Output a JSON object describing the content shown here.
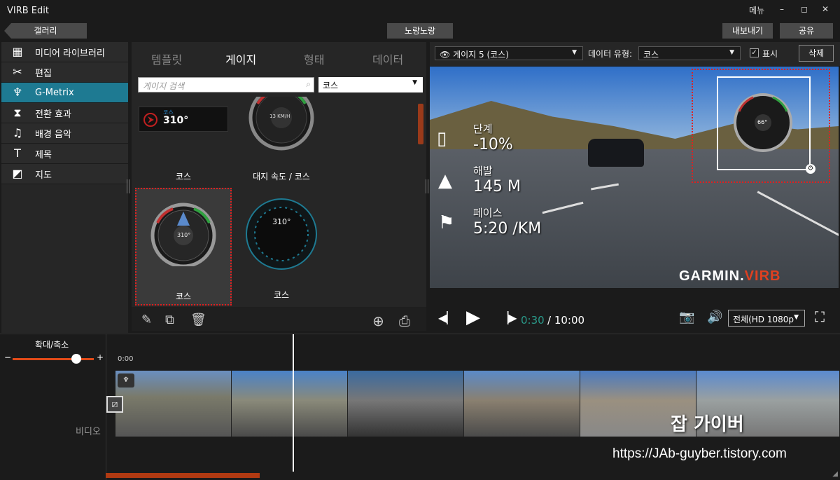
{
  "app": {
    "title": "VIRB Edit",
    "menu_label": "메뉴",
    "minimize": "–",
    "maximize": "◻",
    "close": "✕"
  },
  "nav": {
    "gallery": "갤러리",
    "project_name": "노랑노랑",
    "export": "내보내기",
    "share": "공유"
  },
  "sidebar": {
    "items": [
      {
        "label": "미디어 라이브러리",
        "icon": "film-icon",
        "glyph": "▦"
      },
      {
        "label": "편집",
        "icon": "scissors-icon",
        "glyph": "✂"
      },
      {
        "label": "G-Metrix",
        "icon": "gmetrix-icon",
        "glyph": "♆"
      },
      {
        "label": "전환 효과",
        "icon": "transition-icon",
        "glyph": "⧗"
      },
      {
        "label": "배경 음악",
        "icon": "music-icon",
        "glyph": "♫"
      },
      {
        "label": "제목",
        "icon": "title-icon",
        "glyph": "T"
      },
      {
        "label": "지도",
        "icon": "map-icon",
        "glyph": "◩"
      }
    ],
    "active_index": 2
  },
  "gauge_panel": {
    "tabs": [
      "템플릿",
      "게이지",
      "형태",
      "데이터"
    ],
    "active_tab": 1,
    "search_placeholder": "게이지 검색",
    "type_filter": "코스",
    "gauges": [
      {
        "label": "코스",
        "readout_label": "코스",
        "readout_value": "310°"
      },
      {
        "label": "대지 속도 / 코스",
        "readout_value": "13 KM/H"
      },
      {
        "label": "코스",
        "readout_value": "310°"
      },
      {
        "label": "코스",
        "readout_value": "310°"
      }
    ],
    "selected_index": 2
  },
  "preview": {
    "gauge_select": "게이지 5 (코스)",
    "data_type_label": "데이터 유형:",
    "data_type_value": "코스",
    "show_label": "표시",
    "show_checked": "✓",
    "delete": "삭제",
    "overlay": {
      "grade_label": "단계",
      "grade_value": "-10%",
      "elevation_label": "해발",
      "elevation_value": "145 M",
      "pace_label": "페이스",
      "pace_value": "5:20 /KM",
      "gauge_value": "66°"
    },
    "logo_garmin": "GARMIN.",
    "logo_virb": "VIRB"
  },
  "playback": {
    "current_time": "0:30",
    "separator_total": "/ 10:00",
    "quality": "전체(HD 1080p",
    "play_progress": 0.05
  },
  "timeline": {
    "zoom_label": "확대/축소",
    "zoom_minus": "−",
    "zoom_plus": "+",
    "zoom_level": 0.85,
    "start_time": "0:00",
    "track_label": "비디오",
    "watermark": "잡 가이버",
    "url": "https://JAb-guyber.tistory.com"
  },
  "colors": {
    "accent": "#1e7a92",
    "selection_dotted": "#e02020",
    "time_green": "#2a9a8a",
    "scroll_orange": "#b13a12"
  }
}
